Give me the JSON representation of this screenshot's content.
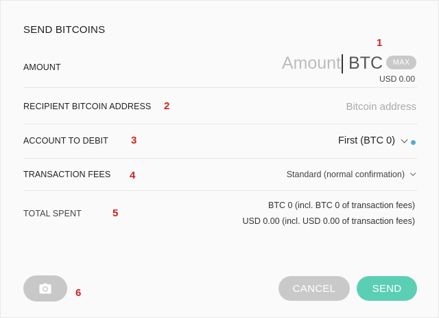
{
  "dialog": {
    "title": "SEND BITCOINS"
  },
  "amount": {
    "label": "AMOUNT",
    "placeholder": "Amount",
    "unit": "BTC",
    "max_label": "MAX",
    "usd_value": "USD 0.00"
  },
  "recipient": {
    "label": "RECIPIENT BITCOIN ADDRESS",
    "placeholder": "Bitcoin address"
  },
  "account": {
    "label": "ACCOUNT TO DEBIT",
    "selected": "First (BTC 0)",
    "status_color": "#5aa9d6"
  },
  "fees": {
    "label": "TRANSACTION FEES",
    "selected": "Standard (normal confirmation)"
  },
  "total": {
    "label": "TOTAL SPENT",
    "btc_line": "BTC 0 (incl. BTC 0 of transaction fees)",
    "usd_line": "USD 0.00 (incl. USD 0.00 of transaction fees)"
  },
  "footer": {
    "camera_icon": "camera-icon",
    "cancel_label": "CANCEL",
    "send_label": "SEND"
  },
  "annotations": [
    "1",
    "2",
    "3",
    "4",
    "5",
    "6"
  ],
  "colors": {
    "accent": "#5bcfb3",
    "annotation": "#d0201e",
    "disabled": "#c9c9c9"
  }
}
